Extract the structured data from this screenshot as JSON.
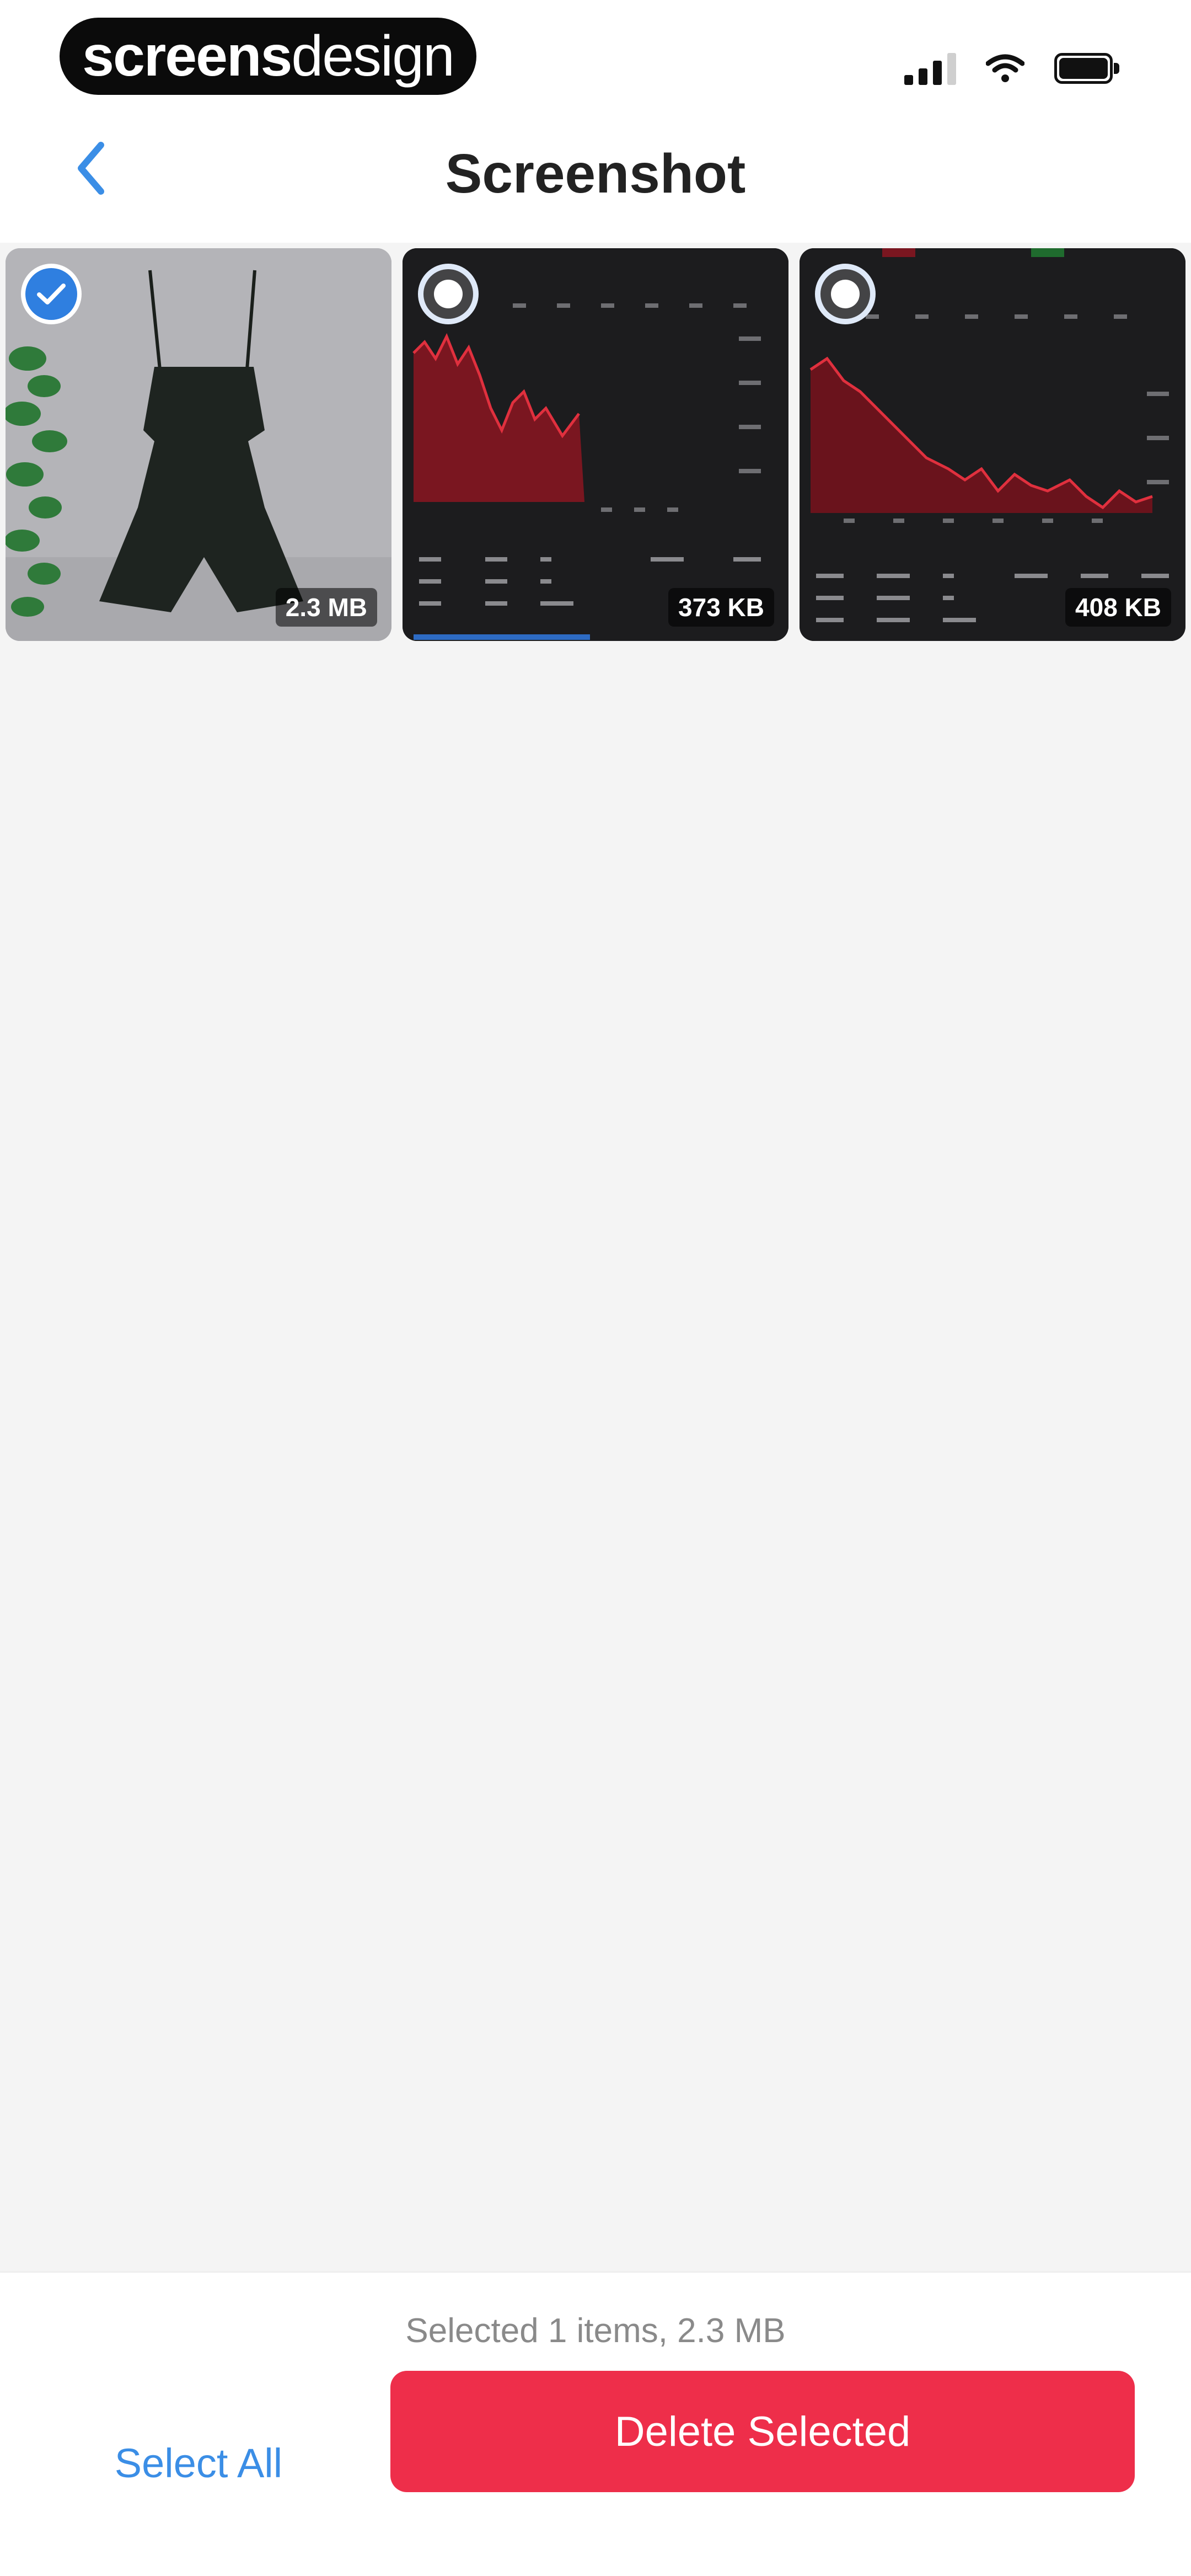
{
  "status_bar": {
    "brand_part1": "screens",
    "brand_part2": "design"
  },
  "nav": {
    "title": "Screenshot"
  },
  "items": [
    {
      "kind": "photo",
      "selected": true,
      "size": "2.3 MB"
    },
    {
      "kind": "chart",
      "selected": false,
      "size": "373 KB"
    },
    {
      "kind": "chart",
      "selected": false,
      "size": "408 KB"
    }
  ],
  "footer": {
    "summary": "Selected 1 items, 2.3 MB",
    "select_all_label": "Select All",
    "delete_label": "Delete Selected"
  },
  "colors": {
    "accent_blue": "#3b8ee6",
    "delete_red": "#ee2e4a"
  }
}
